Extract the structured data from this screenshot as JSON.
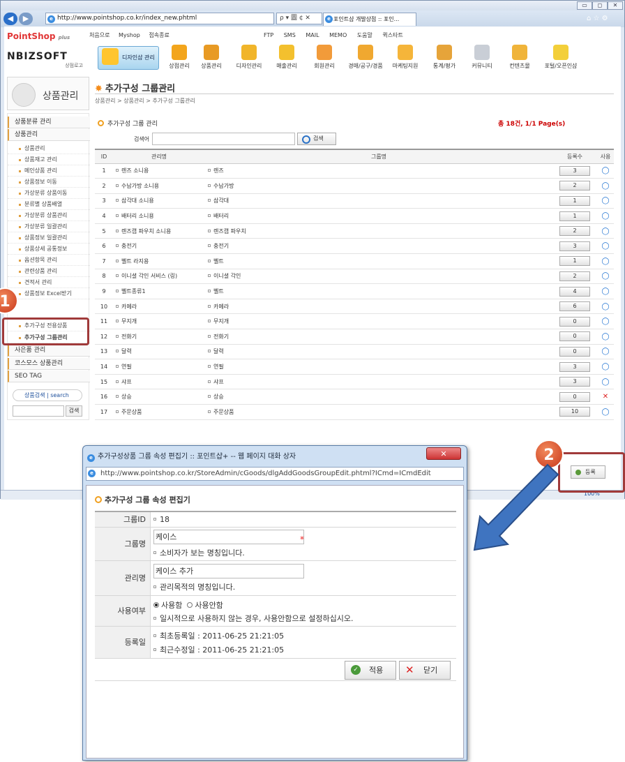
{
  "browser": {
    "url": "http://www.pointshop.co.kr/index_new.phtml",
    "url_controls": "ρ ▾ 圖 ¢ ✕",
    "tab_title": "포인트샵 개발상점 :: 포인...",
    "window_controls": [
      "▭",
      "◻",
      "✕"
    ],
    "right_icons": "⌂ ☆ ⚙",
    "zoom": "100%"
  },
  "header": {
    "logo_top": "PointShop",
    "logo_top_suffix": "plus",
    "logo_brand": "NBIZSOFT",
    "logo_sub": "상점로고",
    "top_links": [
      "처음으로",
      "Myshop",
      "접속종료"
    ],
    "top_tools": [
      "FTP",
      "SMS",
      "MAIL",
      "MEMO",
      "도움말",
      "퀵스타트"
    ],
    "design_button": "디자인샵 관리",
    "icon_menu": [
      "상점관리",
      "상품관리",
      "디자인관리",
      "매출관리",
      "회원관리",
      "경매/공구/경품",
      "마케팅지원",
      "통계/평가",
      "커뮤니티",
      "컨텐츠몰",
      "포털/오픈인샵"
    ]
  },
  "sidebar": {
    "title": "상품관리",
    "categories": [
      "상품분류 관리",
      "상품관리",
      "사은품 관리",
      "코스모스 상품관리",
      "SEO TAG"
    ],
    "items": [
      "상품관리",
      "상품재고 관리",
      "메인상품 관리",
      "상품정보 이동",
      "가상분류 상품이동",
      "분류별 상품배열",
      "가상분류 상품관리",
      "가상분류 일괄관리",
      "상품정보 일괄관리",
      "상품상세 공통정보",
      "옵션항목 관리",
      "관련상품 관리",
      "견적서 관리",
      "상품정보 Excel받기",
      "추가구성 전용상품",
      "추가구성 그룹관리"
    ],
    "search_label": "상품검색 | search",
    "search_button": "검색"
  },
  "callouts": {
    "one": "1",
    "two": "2"
  },
  "main": {
    "title": "추가구성 그룹관리",
    "breadcrumb": "상품관리 > 상품관리 > 추가구성 그룹관리",
    "section_title": "추가구성 그룹 관리",
    "count": "총 18건, 1/1 Page(s)",
    "search_label": "검색어",
    "search_button": "검색",
    "columns": [
      "ID",
      "관리명",
      "그룹명",
      "등록수",
      "사용"
    ],
    "rows": [
      {
        "id": "1",
        "mgr": "렌즈 소니용",
        "grp": "렌즈",
        "cnt": "3",
        "use": "o"
      },
      {
        "id": "2",
        "mgr": "수납가방 소니용",
        "grp": "수납가방",
        "cnt": "2",
        "use": "o"
      },
      {
        "id": "3",
        "mgr": "삼각대 소니용",
        "grp": "삼각대",
        "cnt": "1",
        "use": "o"
      },
      {
        "id": "4",
        "mgr": "배터리 소니용",
        "grp": "배터리",
        "cnt": "1",
        "use": "o"
      },
      {
        "id": "5",
        "mgr": "렌즈캡 파우치 소니용",
        "grp": "렌즈캡 파우치",
        "cnt": "2",
        "use": "o"
      },
      {
        "id": "6",
        "mgr": "충전기",
        "grp": "충전기",
        "cnt": "3",
        "use": "o"
      },
      {
        "id": "7",
        "mgr": "벨트 라지용",
        "grp": "벨트",
        "cnt": "1",
        "use": "o"
      },
      {
        "id": "8",
        "mgr": "이니셜 각인 서비스 (링)",
        "grp": "이니셜 각인",
        "cnt": "2",
        "use": "o"
      },
      {
        "id": "9",
        "mgr": "벨트종류1",
        "grp": "벨트",
        "cnt": "4",
        "use": "o"
      },
      {
        "id": "10",
        "mgr": "카메라",
        "grp": "카메라",
        "cnt": "6",
        "use": "o"
      },
      {
        "id": "11",
        "mgr": "무지개",
        "grp": "무지개",
        "cnt": "0",
        "use": "o"
      },
      {
        "id": "12",
        "mgr": "전화기",
        "grp": "전화기",
        "cnt": "0",
        "use": "o"
      },
      {
        "id": "13",
        "mgr": "달력",
        "grp": "달력",
        "cnt": "0",
        "use": "o"
      },
      {
        "id": "14",
        "mgr": "연필",
        "grp": "연필",
        "cnt": "3",
        "use": "o"
      },
      {
        "id": "15",
        "mgr": "샤프",
        "grp": "샤프",
        "cnt": "3",
        "use": "o"
      },
      {
        "id": "16",
        "mgr": "상승",
        "grp": "상승",
        "cnt": "0",
        "use": "x"
      },
      {
        "id": "17",
        "mgr": "주문상품",
        "grp": "주문상품",
        "cnt": "10",
        "use": "o"
      }
    ],
    "register_button": "등록"
  },
  "dialog": {
    "title": "추가구성상품 그룹 속성 편집기 :: 포인트샵+ -- 웹 페이지 대화 상자",
    "url": "http://www.pointshop.co.kr/StoreAdmin/cGoods/dlgAddGoodsGroupEdit.phtml?ICmd=ICmdEdit",
    "heading": "추가구성 그룹 속성 편집기",
    "group_id_label": "그룹ID",
    "group_id": "18",
    "group_name_label": "그룹명",
    "group_name": "케이스",
    "group_name_hint": "소비자가 보는 명칭입니다.",
    "mgr_name_label": "관리명",
    "mgr_name": "케이스 추가",
    "mgr_name_hint": "관리목적의 명칭입니다.",
    "use_label": "사용여부",
    "use_on": "사용함",
    "use_off": "사용안함",
    "use_hint": "일시적으로 사용하지 않는 경우, 사용안함으로 설정하십시오.",
    "date_label": "등록일",
    "created": "최초등록일 : 2011-06-25 21:21:05",
    "modified": "최근수정일 : 2011-06-25 21:21:05",
    "apply_button": "적용",
    "close_button": "닫기"
  }
}
